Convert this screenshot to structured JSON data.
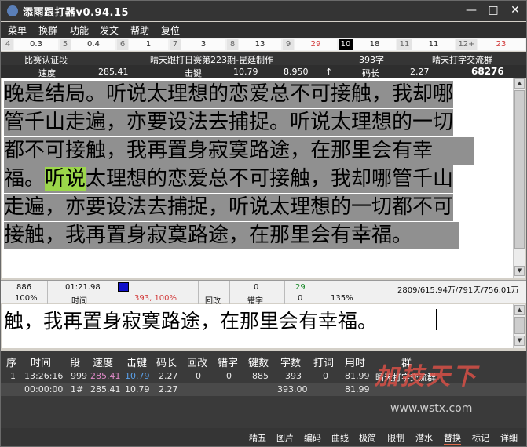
{
  "title": "添雨跟打器v0.94.15",
  "window": {
    "minimize": "—",
    "maximize": "□",
    "close": "✕"
  },
  "menu": [
    "菜单",
    "换群",
    "功能",
    "发文",
    "帮助",
    "复位"
  ],
  "numbers": [
    {
      "k": "4",
      "v": "0.3"
    },
    {
      "k": "5",
      "v": "0.4"
    },
    {
      "k": "6",
      "v": "1"
    },
    {
      "k": "7",
      "v": "3"
    },
    {
      "k": "8",
      "v": "13"
    },
    {
      "k": "9",
      "v": "29"
    },
    {
      "k": "10",
      "v": "18"
    },
    {
      "k": "11",
      "v": "11"
    },
    {
      "k": "12+",
      "v": "23"
    }
  ],
  "info1": {
    "left": "比赛认证段",
    "center": "晴天跟打日赛第223期-昆廷制作",
    "count": "393字",
    "group": "晴天打字交流群"
  },
  "info2": {
    "speed_label": "速度",
    "speed_value": "285.41",
    "keys_label": "击键",
    "keys_value": "10.79",
    "extra_value": "8.950",
    "arrow": "↑",
    "code_label": "码长",
    "code_value": "2.27",
    "total": "68276"
  },
  "article": {
    "lines": [
      "晚是结局。听说太理想的恋爱总不可接触，我却哪",
      "管千山走遍，亦要设法去捕捉。听说太理想的一切",
      "都不可接触，我再置身寂寞路途，在那里会有幸",
      "福。",
      "听说",
      "太理想的恋爱总不可接触，我却哪管千山",
      "走遍，亦要设法去捕捉，听说太理想的一切都不可",
      "接触，我再置身寂寞路途，在那里会有幸福。"
    ]
  },
  "stats": {
    "c1_top": "886",
    "c1_bot": "100%",
    "c2_top": "01:21.98",
    "c2_bot": "时间",
    "c3_bot": "393, 100%",
    "c4_bot": "回改",
    "c5_top": "0",
    "c5_bot": "错字",
    "c6_top": "29",
    "c6_bot": "0",
    "c7_bot": "135%",
    "right": "2809/615.94万/791天/756.01万"
  },
  "input_text": "触，我再置身寂寞路途，在那里会有幸福。",
  "table": {
    "headers": [
      "序",
      "时间",
      "段",
      "速度",
      "击键",
      "码长",
      "回改",
      "错字",
      "键数",
      "字数",
      "打词",
      "用时",
      "群"
    ],
    "rows": [
      [
        "1",
        "13:26:16",
        "999",
        "285.41",
        "10.79",
        "2.27",
        "0",
        "0",
        "885",
        "393",
        "0",
        "81.99",
        "晴天打字交流群"
      ],
      [
        "",
        "00:00:00",
        "1#",
        "285.41",
        "10.79",
        "2.27",
        "",
        "",
        "",
        "393.00",
        "",
        "81.99",
        ""
      ]
    ]
  },
  "watermark": {
    "brand": "加技天下",
    "url": "www.wstx.com"
  },
  "bottom": [
    "精五",
    "图片",
    "编码",
    "曲线",
    "极简",
    "限制",
    "潜水",
    "替换",
    "标记",
    "详细"
  ],
  "colors": {
    "speed": "#e08ac8",
    "keys": "#5aa0e8",
    "highlight": "#9bd74a"
  }
}
